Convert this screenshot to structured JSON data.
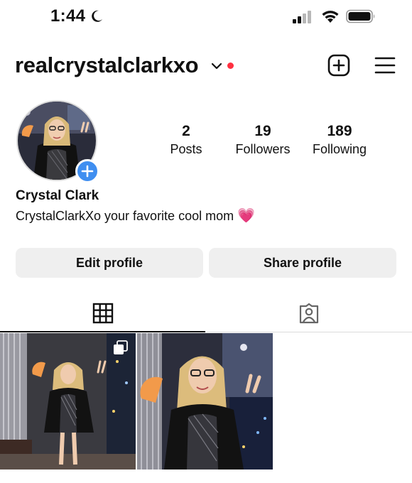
{
  "status_bar": {
    "time": "1:44",
    "icons": [
      "moon-icon",
      "cellular-signal-icon",
      "wifi-icon",
      "battery-icon"
    ]
  },
  "header": {
    "username": "realcrystalclarkxo",
    "icons": [
      "chevron-down-icon",
      "notification-dot",
      "new-post-icon",
      "menu-icon"
    ],
    "notification_color": "#ff3040"
  },
  "profile": {
    "full_name": "Crystal Clark",
    "bio": "CrystalClarkXo your favorite cool mom",
    "bio_emoji": "💗",
    "add_story_color": "#3f8ef0"
  },
  "stats": [
    {
      "value": "2",
      "label": "Posts"
    },
    {
      "value": "19",
      "label": "Followers"
    },
    {
      "value": "189",
      "label": "Following"
    }
  ],
  "actions": {
    "edit_profile": "Edit profile",
    "share_profile": "Share profile"
  },
  "tabs": [
    {
      "icon": "grid-icon",
      "active": true
    },
    {
      "icon": "tagged-icon",
      "active": false
    }
  ],
  "posts": [
    {
      "description_icon": "multiple-photos-icon"
    },
    {}
  ]
}
